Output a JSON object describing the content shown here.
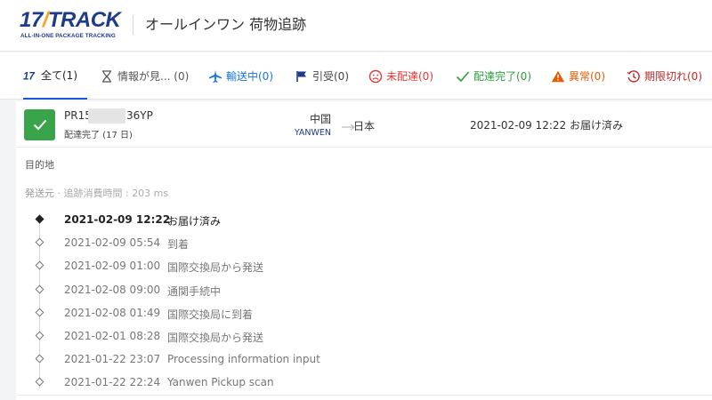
{
  "header": {
    "logo_main_a": "17",
    "logo_main_b": "TRACK",
    "logo_sub": "ALL-IN-ONE PACKAGE TRACKING",
    "title": "オールインワン 荷物追跡"
  },
  "tabs": [
    {
      "icon": "17track-logo-icon",
      "label": "全て(1)",
      "color": "#222222",
      "active": true
    },
    {
      "icon": "hourglass-icon",
      "label": "情報が見... (0)",
      "color": "#555555"
    },
    {
      "icon": "airplane-icon",
      "label": "輸送中(0)",
      "color": "#1a73e8"
    },
    {
      "icon": "flag-icon",
      "label": "引受(0)",
      "color": "#555555"
    },
    {
      "icon": "sad-face-icon",
      "label": "未配達(0)",
      "color": "#e53935"
    },
    {
      "icon": "checkmark-icon",
      "label": "配達完了(0)",
      "color": "#2e9d3e"
    },
    {
      "icon": "warning-icon",
      "label": "異常(0)",
      "color": "#e65c00"
    },
    {
      "icon": "expired-clock-icon",
      "label": "期限切れ(0)",
      "color": "#c62828"
    }
  ],
  "shipment": {
    "tracking_prefix": "PR15",
    "tracking_suffix": "36YP",
    "status_sub": "配達完了 (17 日)",
    "origin_country": "中国",
    "carrier": "YANWEN",
    "destination_country": "日本",
    "latest_event": "2021-02-09 12:22  お届け済み",
    "status_color": "#3aa44b"
  },
  "details": {
    "destination_label": "目的地",
    "origin_label": "発送元",
    "elapsed": " · 追跡消費時間 : 203 ms"
  },
  "events": [
    {
      "time": "2021-02-09 12:22",
      "desc": "お届け済み"
    },
    {
      "time": "2021-02-09 05:54",
      "desc": "到着"
    },
    {
      "time": "2021-02-09 01:00",
      "desc": "国際交換局から発送"
    },
    {
      "time": "2021-02-08 09:00",
      "desc": "通関手続中"
    },
    {
      "time": "2021-02-08 01:49",
      "desc": "国際交換局に到着"
    },
    {
      "time": "2021-02-01 08:28",
      "desc": "国際交換局から発送"
    },
    {
      "time": "2021-01-22 23:07",
      "desc": "Processing information input"
    },
    {
      "time": "2021-01-22 22:24",
      "desc": "Yanwen Pickup scan"
    }
  ]
}
